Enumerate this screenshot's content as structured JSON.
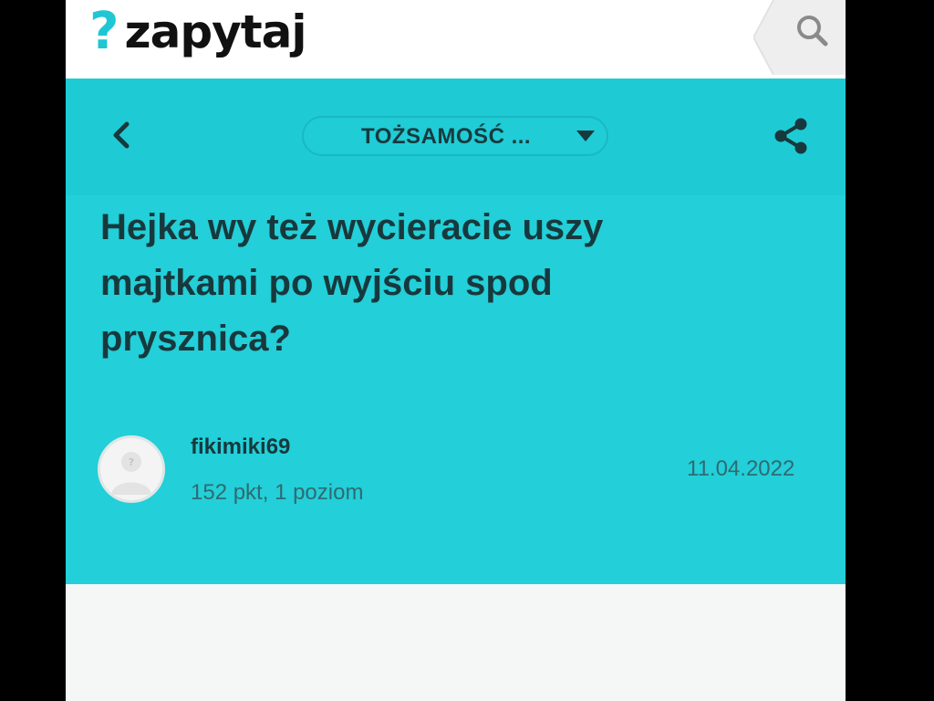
{
  "app": {
    "logo_mark": "?",
    "logo_text": "zapytaj",
    "accent_color": "#23cfd8",
    "logo_color": "#1ec7d3"
  },
  "header": {
    "search_icon": "search-icon"
  },
  "toolbar": {
    "back_icon": "chevron-left-icon",
    "category_label": "TOŻSAMOŚĆ ...",
    "category_icon": "caret-down-icon",
    "share_icon": "share-icon"
  },
  "question": {
    "title": "Hejka wy też wycieracie uszy majtkami po wyjściu spod prysznica?",
    "author": {
      "name": "fikimiki69",
      "stats": "152 pkt, 1 poziom",
      "avatar_glyph": "?"
    },
    "date": "11.04.2022"
  }
}
